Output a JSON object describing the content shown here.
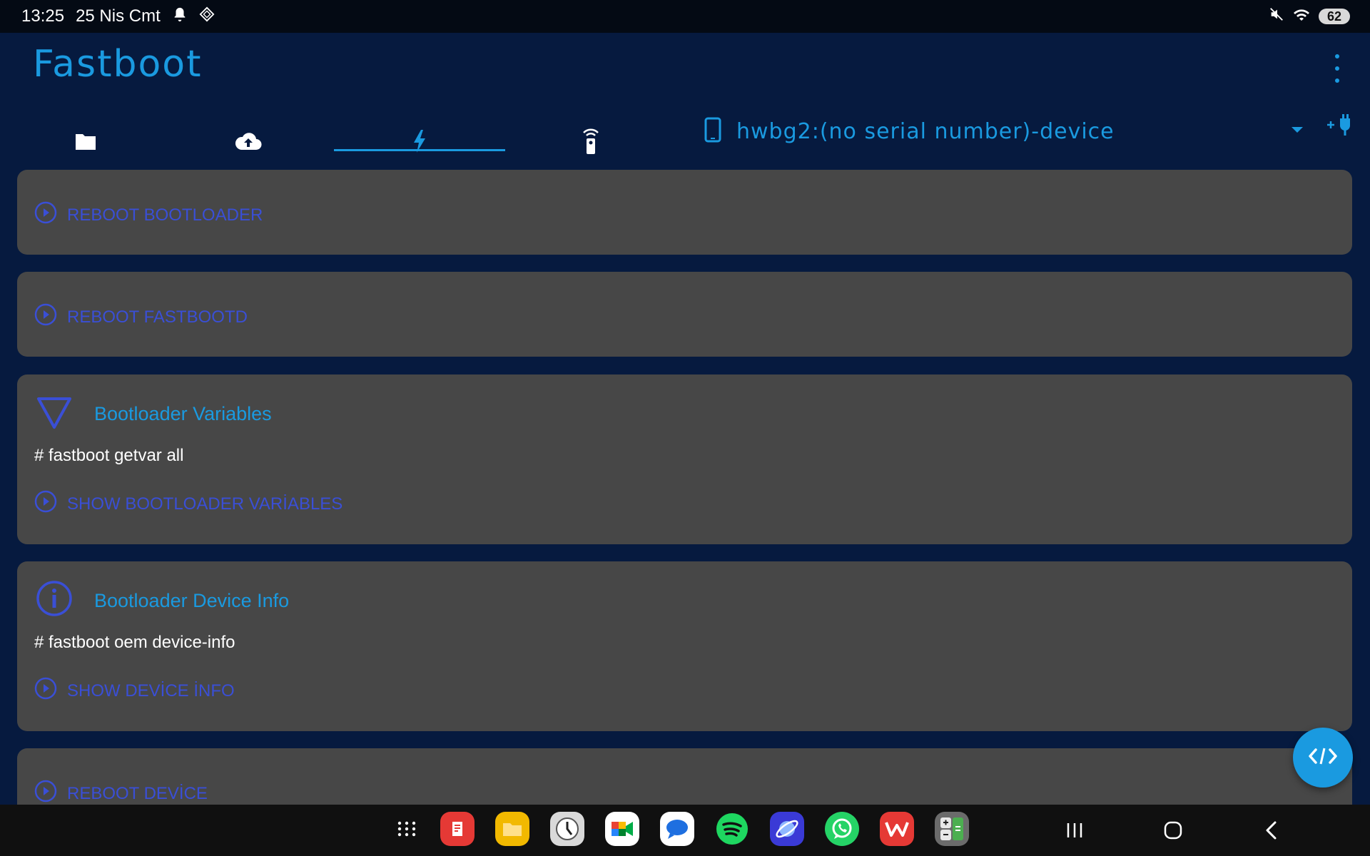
{
  "status_bar": {
    "time": "13:25",
    "date": "25 Nis Cmt",
    "battery": "62",
    "icons": [
      "bell-icon",
      "vpn-icon",
      "mute-icon",
      "wifi-icon"
    ]
  },
  "header": {
    "title": "Fastboot",
    "tabs": [
      {
        "icon": "folder-icon"
      },
      {
        "icon": "upload-cloud-icon"
      },
      {
        "icon": "flash-icon",
        "selected": true
      },
      {
        "icon": "remote-icon"
      }
    ],
    "device": {
      "name": "hwbg2:(no serial number)-device",
      "icon": "phone-icon"
    }
  },
  "cards": {
    "reboot_bootloader": {
      "button": "REBOOT BOOTLOADER"
    },
    "reboot_fastbootd": {
      "button": "REBOOT FASTBOOTD"
    },
    "bootloader_variables": {
      "title": "Bootloader Variables",
      "command": "# fastboot getvar all",
      "button": "SHOW BOOTLOADER VARİABLES"
    },
    "bootloader_device_info": {
      "title": "Bootloader Device Info",
      "command": "# fastboot oem device-info",
      "button": "SHOW DEVİCE İNFO"
    },
    "reboot_device": {
      "button": "REBOOT DEVİCE"
    }
  },
  "colors": {
    "background": "#061a3f",
    "card": "#474747",
    "accent": "#1a9ae0",
    "action": "#3a4fd6"
  },
  "taskbar": {
    "apps": [
      "app-drawer-icon",
      "notes-app-icon",
      "files-app-icon",
      "clock-app-icon",
      "meet-app-icon",
      "messages-app-icon",
      "spotify-app-icon",
      "browser-app-icon",
      "whatsapp-app-icon",
      "wps-app-icon",
      "calculator-app-icon"
    ]
  }
}
